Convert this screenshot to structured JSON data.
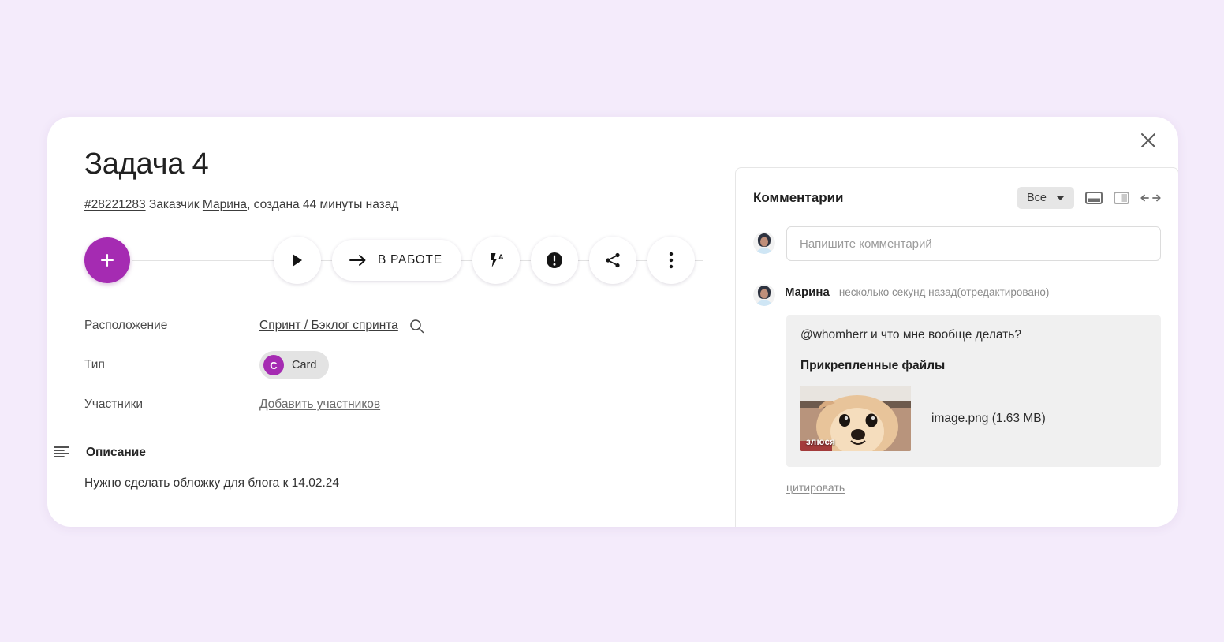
{
  "theme": {
    "page_bg": "#f4ebfb",
    "accent_purple": "#a52bb2",
    "modal_bg": "#ffffff",
    "comment_bg": "#f0f0f0",
    "chip_bg": "#e3e3e3"
  },
  "task": {
    "title": "Задача 4",
    "id": "#28221283",
    "customer_label": "Заказчик",
    "customer_name": "Марина",
    "created_text": ", создана 44 минуты назад"
  },
  "toolbar": {
    "add_label": "+",
    "play_label": "play-icon",
    "status_label": "В РАБОТЕ",
    "flash_label": "flash-auto-icon",
    "priority_label": "priority-icon",
    "share_label": "share-icon",
    "more_label": "more-icon"
  },
  "properties": [
    {
      "label": "Расположение",
      "value": "Спринт / Бэклог спринта",
      "has_search_icon": true
    },
    {
      "label": "Тип",
      "value": "Card",
      "badge_letter": "C"
    },
    {
      "label": "Участники",
      "value": "Добавить участников"
    }
  ],
  "description": {
    "heading": "Описание",
    "body": "Нужно сделать обложку для блога к 14.02.24"
  },
  "comments": {
    "title": "Комментарии",
    "filter_value": "Все",
    "layout_icons": [
      "split-horizontal-icon",
      "split-vertical-icon",
      "expand-arrows-icon"
    ],
    "composer_placeholder": "Напишите комментарий",
    "composer_value": "",
    "items": [
      {
        "author": "Марина",
        "time": "несколько секунд назад(отредактировано)",
        "text": "@whomherr и что мне вообще делать?",
        "files_heading": "Прикрепленные файлы",
        "attachment": {
          "thumb_caption": "злюся",
          "link": "image.png (1.63 MB)"
        },
        "quote_label": "цитировать"
      }
    ]
  },
  "close_label": "close-icon"
}
